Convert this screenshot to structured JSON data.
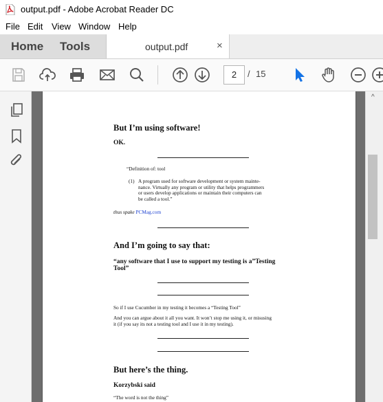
{
  "window": {
    "title": "output.pdf - Adobe Acrobat Reader DC"
  },
  "menu": [
    "File",
    "Edit",
    "View",
    "Window",
    "Help"
  ],
  "tabs": {
    "home": "Home",
    "tools": "Tools",
    "document": "output.pdf",
    "close_glyph": "×"
  },
  "toolbar": {
    "icons": [
      "save-icon",
      "upload-icon",
      "print-icon",
      "mail-icon",
      "search-icon",
      "page-up-icon",
      "page-down-icon",
      "select-cursor-icon",
      "hand-icon",
      "zoom-out-icon",
      "zoom-in-icon"
    ],
    "page_current": "2",
    "page_separator": "/",
    "page_total": "15",
    "accent": "#1473e6"
  },
  "left_rail": [
    "pages-icon",
    "bookmark-icon",
    "attachment-icon"
  ],
  "scrollbar": {
    "up_glyph": "^"
  },
  "pdf": {
    "heading1": "But I’m using software!",
    "ok": "OK.",
    "definition_title": "“Definition of: tool",
    "definition_number": "(1)",
    "definition_lines": [
      "A program used for software development or system mainte-",
      "nance. Virtually any program or utility that helps programmers",
      "or users develop applications or maintain their computers can",
      "be called a tool.”"
    ],
    "thus_spake": "thus spake",
    "pcmag": "PCMag.com",
    "heading2": "And I’m going to say that:",
    "quote_line1": "“any software that I use to support my testing is a”Testing",
    "quote_line2": "Tool”",
    "cucumber_line": "So if I use Cucumber in my testing it becomes a “Testing Tool”",
    "argue_line1": "And you can argue about it all you want. It won’t stop me using it, or misusing",
    "argue_line2": "it (if you say its not a testing tool and I use it in my testing).",
    "heading3": "But here’s the thing.",
    "korzybski": "Korzybski said",
    "word_quote": "“The word is not the thing”"
  }
}
